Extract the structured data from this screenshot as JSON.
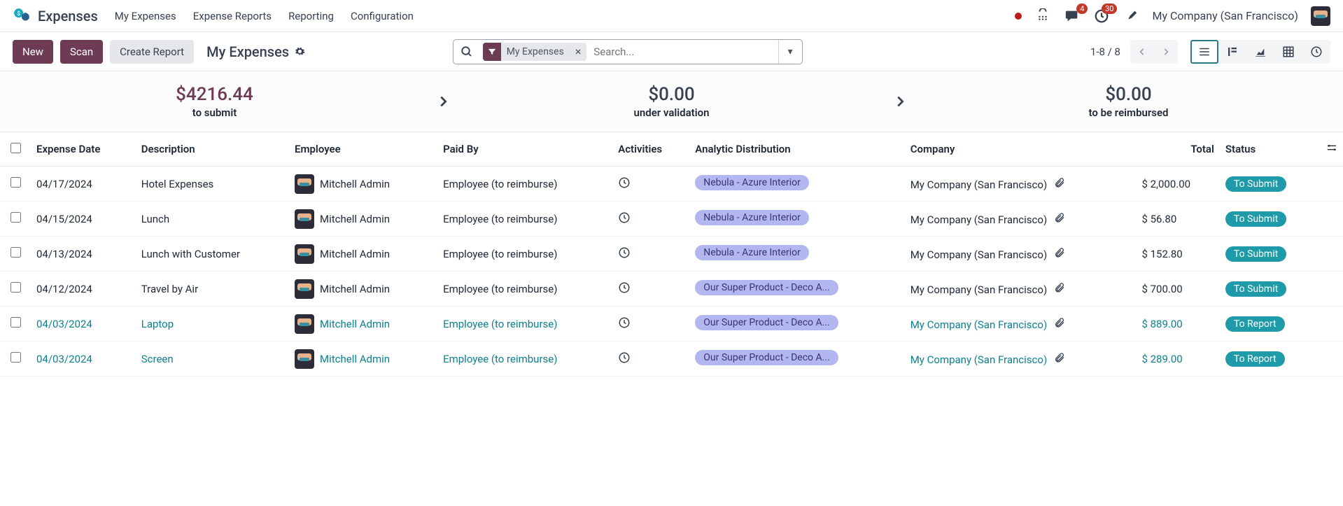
{
  "nav": {
    "app": "Expenses",
    "links": [
      "My Expenses",
      "Expense Reports",
      "Reporting",
      "Configuration"
    ],
    "msg_badge": "4",
    "activity_badge": "30",
    "company": "My Company (San Francisco)"
  },
  "toolbar": {
    "new": "New",
    "scan": "Scan",
    "create_report": "Create Report",
    "title": "My Expenses",
    "filter_chip": "My Expenses",
    "search_placeholder": "Search...",
    "pager": "1-8 / 8"
  },
  "summary": {
    "to_submit_amount": "$4216.44",
    "to_submit_label": "to submit",
    "under_validation_amount": "$0.00",
    "under_validation_label": "under validation",
    "to_reimburse_amount": "$0.00",
    "to_reimburse_label": "to be reimbursed"
  },
  "columns": {
    "date": "Expense Date",
    "description": "Description",
    "employee": "Employee",
    "paid_by": "Paid By",
    "activities": "Activities",
    "analytic": "Analytic Distribution",
    "company": "Company",
    "total": "Total",
    "status": "Status"
  },
  "rows": [
    {
      "date": "04/17/2024",
      "desc": "Hotel Expenses",
      "emp": "Mitchell Admin",
      "paid": "Employee (to reimburse)",
      "analytic": "Nebula - Azure Interior",
      "company": "My Company (San Francisco)",
      "total": "$ 2,000.00",
      "status": "To Submit",
      "link": false
    },
    {
      "date": "04/15/2024",
      "desc": "Lunch",
      "emp": "Mitchell Admin",
      "paid": "Employee (to reimburse)",
      "analytic": "Nebula - Azure Interior",
      "company": "My Company (San Francisco)",
      "total": "$ 56.80",
      "status": "To Submit",
      "link": false
    },
    {
      "date": "04/13/2024",
      "desc": "Lunch with Customer",
      "emp": "Mitchell Admin",
      "paid": "Employee (to reimburse)",
      "analytic": "Nebula - Azure Interior",
      "company": "My Company (San Francisco)",
      "total": "$ 152.80",
      "status": "To Submit",
      "link": false
    },
    {
      "date": "04/12/2024",
      "desc": "Travel by Air",
      "emp": "Mitchell Admin",
      "paid": "Employee (to reimburse)",
      "analytic": "Our Super Product - Deco A...",
      "company": "My Company (San Francisco)",
      "total": "$ 700.00",
      "status": "To Submit",
      "link": false
    },
    {
      "date": "04/03/2024",
      "desc": "Laptop",
      "emp": "Mitchell Admin",
      "paid": "Employee (to reimburse)",
      "analytic": "Our Super Product - Deco A...",
      "company": "My Company (San Francisco)",
      "total": "$ 889.00",
      "status": "To Report",
      "link": true
    },
    {
      "date": "04/03/2024",
      "desc": "Screen",
      "emp": "Mitchell Admin",
      "paid": "Employee (to reimburse)",
      "analytic": "Our Super Product - Deco A...",
      "company": "My Company (San Francisco)",
      "total": "$ 289.00",
      "status": "To Report",
      "link": true
    }
  ]
}
